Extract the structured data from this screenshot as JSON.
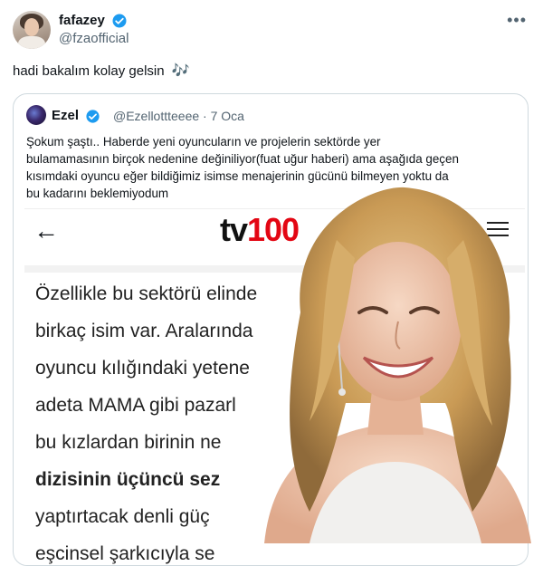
{
  "tweet": {
    "display_name": "fafazey",
    "handle": "@fzaofficial",
    "text": "hadi bakalım kolay gelsin",
    "emoji": "🎶"
  },
  "quote": {
    "display_name": "Ezel",
    "handle": "@Ezellottteeee",
    "separator": "·",
    "date": "7 Oca",
    "text_lines": [
      "Şokum şaştı.. Haberde yeni oyuncuların ve projelerin sektörde yer",
      "bulamamasının birçok nedenine değiniliyor(fuat uğur haberi) ama aşağıda geçen",
      "kısımdaki oyuncu eğer bildiğimiz isimse menajerinin gücünü bilmeyen yoktu da",
      "bu kadarını beklemiyodum"
    ]
  },
  "article": {
    "logo_prefix": "tv",
    "logo_number": "100",
    "lines": [
      "Özellikle bu sektörü elinde",
      "birkaç isim var. Aralarında",
      "oyuncu kılığındaki yetene",
      "adeta MAMA gibi pazarl",
      "bu kızlardan birinin ne",
      "dizisinin üçüncü sez",
      "yaptırtacak denli güç",
      "eşcinsel şarkıcıyla se"
    ]
  },
  "colors": {
    "verified_blue": "#1d9bf0",
    "secondary_text": "#536471",
    "logo_red": "#e30613"
  }
}
